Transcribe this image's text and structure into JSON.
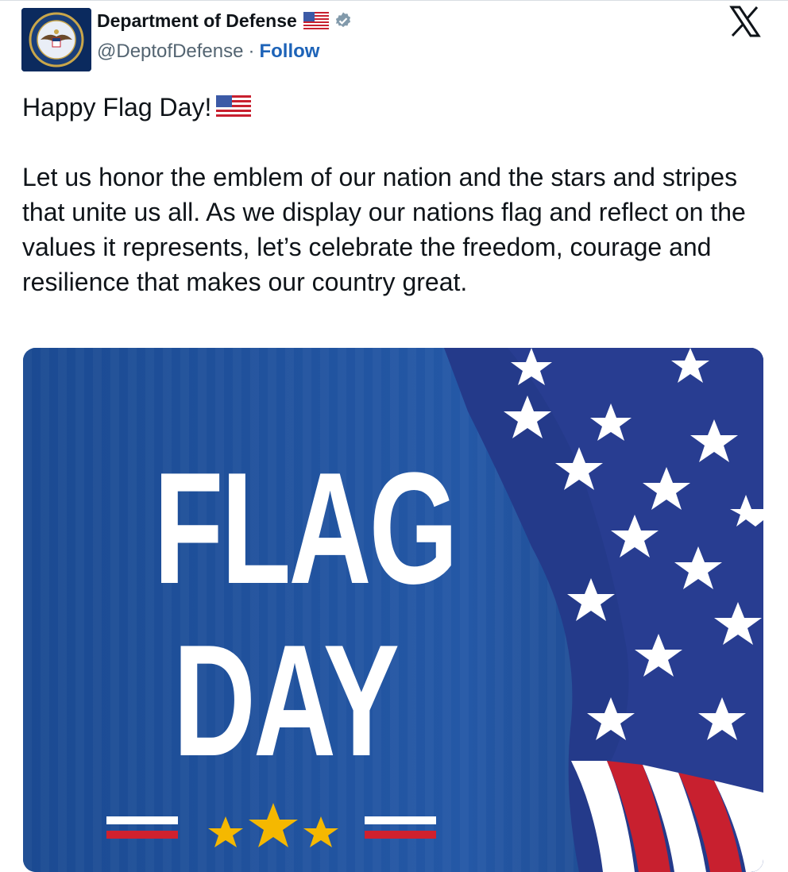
{
  "author": {
    "display_name": "Department of Defense",
    "handle": "@DeptofDefense",
    "separator": "·",
    "follow_label": "Follow"
  },
  "post": {
    "line1": "Happy Flag Day!",
    "body": "Let us honor the emblem of our nation and the stars and stripes that unite us all. As we display our nations flag and reflect on the values it represents, let’s celebrate the freedom, courage and resilience that makes our country great."
  },
  "media": {
    "title_line1": "FLAG",
    "title_line2": "DAY"
  },
  "icons": {
    "close": "x-logo-icon",
    "verified": "verified-badge-icon",
    "flag": "us-flag-emoji-icon"
  },
  "colors": {
    "follow": "#1d63b8",
    "banner_blue": "#1f4f98",
    "flag_red": "#c8202f",
    "star_gold": "#f5b800"
  }
}
